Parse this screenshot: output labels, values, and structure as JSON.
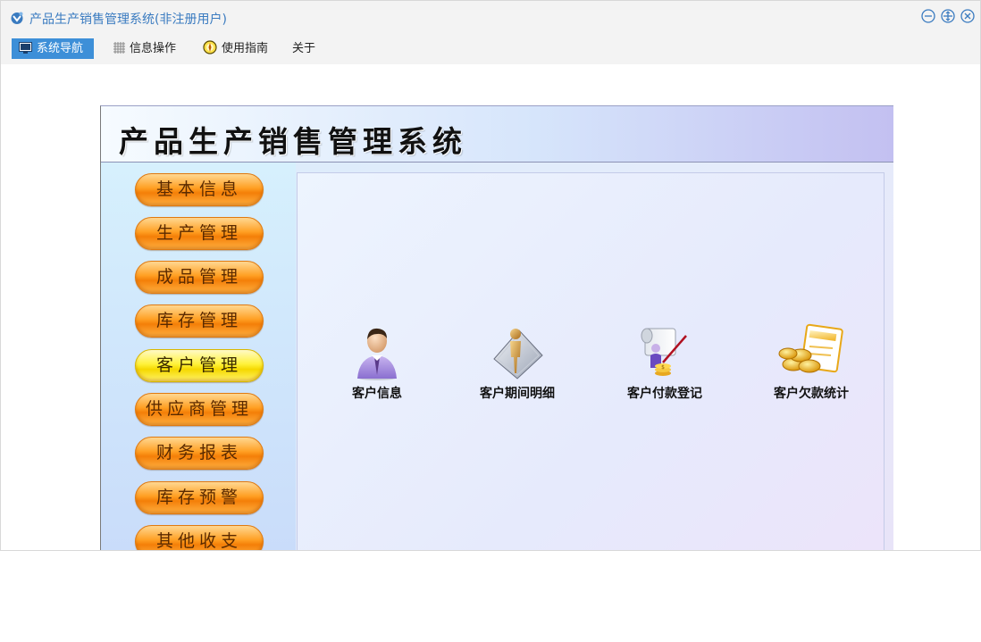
{
  "window": {
    "title": "产品生产销售管理系统(非注册用户)"
  },
  "menu": [
    {
      "label": "系统导航",
      "icon": "monitor-icon",
      "active": true
    },
    {
      "label": "信息操作",
      "icon": "grid-icon",
      "active": false
    },
    {
      "label": "使用指南",
      "icon": "compass-icon",
      "active": false
    },
    {
      "label": "关于",
      "icon": "",
      "active": false
    }
  ],
  "app": {
    "banner_title": "产品生产销售管理系统",
    "sidebar": [
      {
        "label": "基本信息"
      },
      {
        "label": "生产管理"
      },
      {
        "label": "成品管理"
      },
      {
        "label": "库存管理"
      },
      {
        "label": "客户管理",
        "active": true
      },
      {
        "label": "供应商管理"
      },
      {
        "label": "财务报表"
      },
      {
        "label": "库存预警"
      },
      {
        "label": "其他收支"
      }
    ],
    "tools": [
      {
        "label": "客户信息",
        "icon": "customer-person-icon"
      },
      {
        "label": "客户期间明细",
        "icon": "customer-period-detail-icon"
      },
      {
        "label": "客户付款登记",
        "icon": "payment-register-icon"
      },
      {
        "label": "客户欠款统计",
        "icon": "debt-statistics-icon"
      }
    ]
  }
}
